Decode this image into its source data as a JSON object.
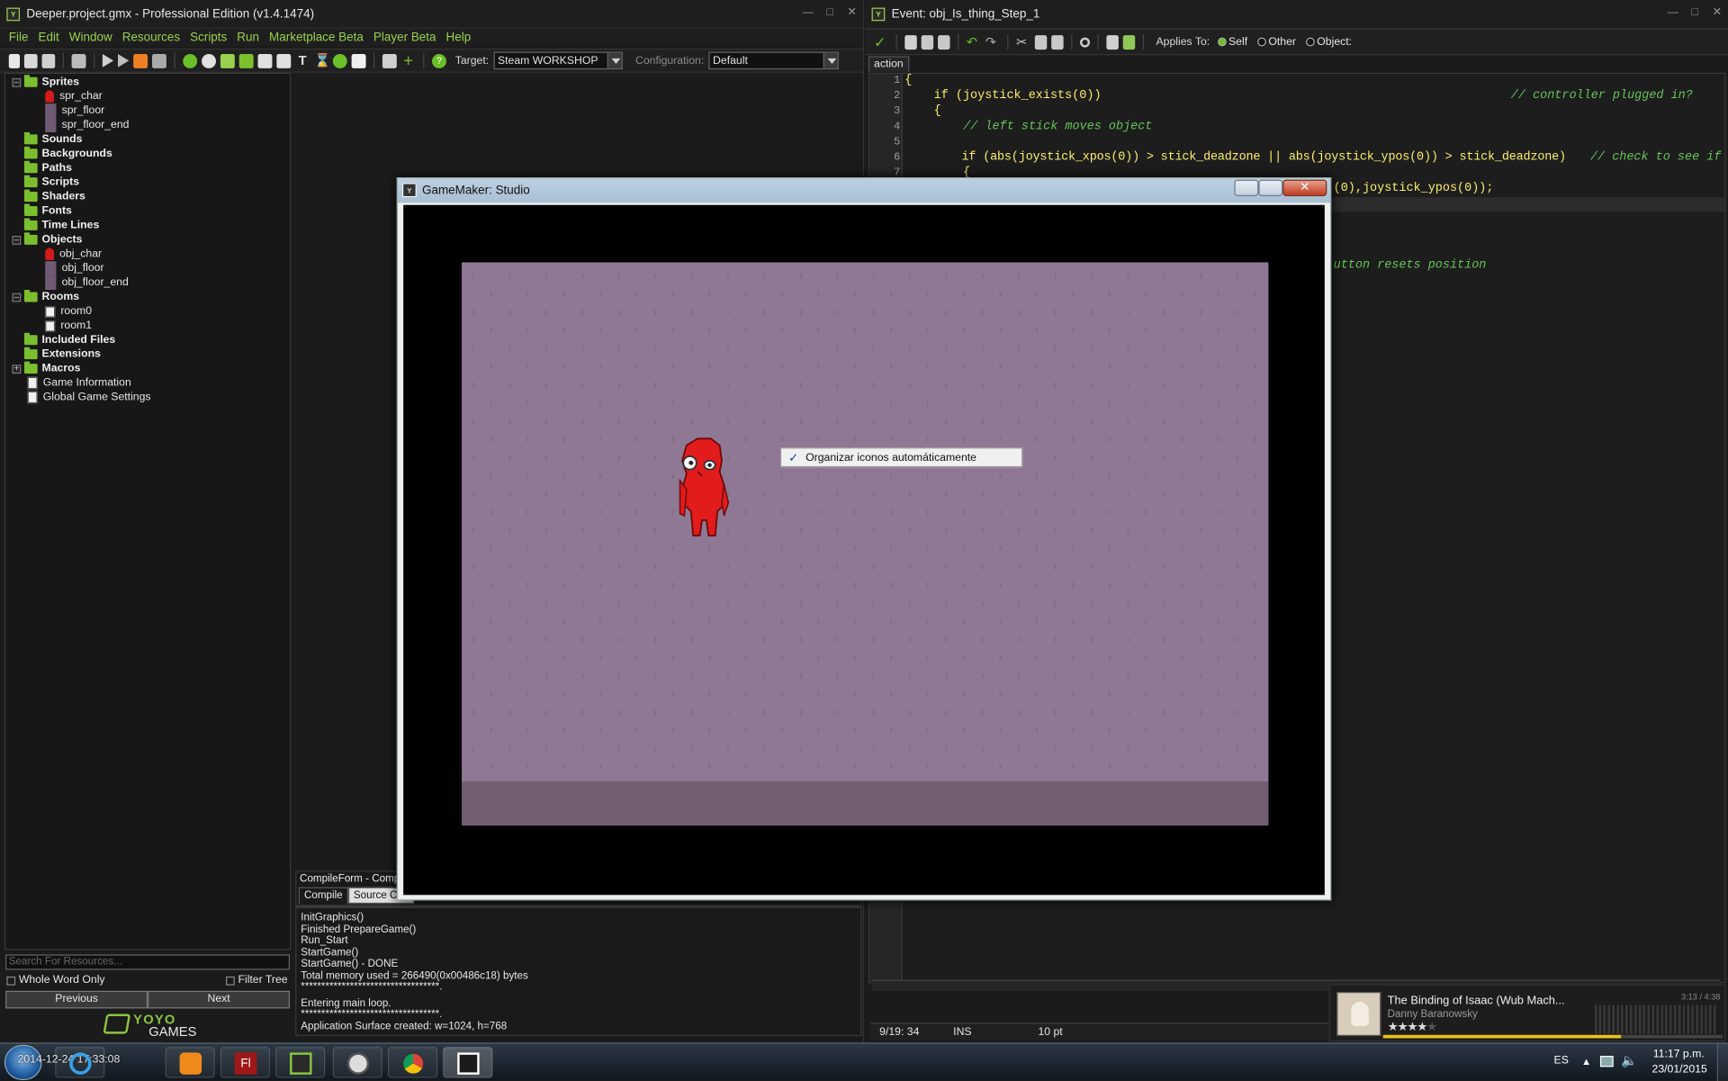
{
  "left_window": {
    "title": "Deeper.project.gmx  -  Professional Edition (v1.4.1474)",
    "menu": [
      "File",
      "Edit",
      "Window",
      "Resources",
      "Scripts",
      "Run",
      "Marketplace Beta",
      "Player Beta",
      "Help"
    ],
    "target_label": "Target:",
    "target_value": "Steam WORKSHOP",
    "configuration_label": "Configuration:",
    "configuration_value": "Default"
  },
  "resource_tree": {
    "sprites": "Sprites",
    "spr_char": "spr_char",
    "spr_floor": "spr_floor",
    "spr_floor_end": "spr_floor_end",
    "sounds": "Sounds",
    "backgrounds": "Backgrounds",
    "paths": "Paths",
    "scripts": "Scripts",
    "shaders": "Shaders",
    "fonts": "Fonts",
    "timelines": "Time Lines",
    "objects": "Objects",
    "obj_char": "obj_char",
    "obj_floor": "obj_floor",
    "obj_floor_end": "obj_floor_end",
    "rooms": "Rooms",
    "room0": "room0",
    "room1": "room1",
    "included_files": "Included Files",
    "extensions": "Extensions",
    "macros": "Macros",
    "game_information": "Game Information",
    "global_settings": "Global Game Settings"
  },
  "search": {
    "placeholder": "Search For Resources...",
    "whole_word": "Whole Word Only",
    "filter_tree": "Filter Tree",
    "previous": "Previous",
    "next": "Next",
    "brand_line1": "YOYO",
    "brand_line2": "GAMES"
  },
  "compile": {
    "title": "CompileForm - Compile",
    "tab_compile": "Compile",
    "tab_source": "Source Con",
    "lines": [
      "InitGraphics()",
      "Finished PrepareGame()",
      "Run_Start",
      "StartGame()",
      "StartGame() - DONE",
      "Total memory used = 266490(0x00486c18) bytes",
      "**********************************.",
      "Entering main loop.",
      "**********************************.",
      "Application Surface created: w=1024, h=768"
    ]
  },
  "code_editor": {
    "title": "Event: obj_Is_thing_Step_1",
    "applies_to": "Applies To:",
    "self": "Self",
    "other": "Other",
    "object": "Object:",
    "tab": "action",
    "line_numbers": [
      "1",
      "2",
      "3",
      "4",
      "5",
      "6",
      "7"
    ],
    "line1": "{",
    "line2": "    if (joystick_exists(0))",
    "line2_comment": "// controller plugged in?",
    "line3": "    {",
    "line4_comment": "// left stick moves object",
    "line6": "        if (abs(joystick_xpos(0)) > stick_deadzone || abs(joystick_ypos(0)) > stick_deadzone)",
    "line6_comment": "// check to see if",
    "line7": "        {",
    "line8_fragment": "(0),joystick_ypos(0));",
    "line_fragment_comment": "utton resets position",
    "status_pos": "9/19:  34",
    "status_ins": "INS",
    "status_font": "10 pt"
  },
  "game_window": {
    "title": "GameMaker: Studio",
    "context_menu_item": "Organizar iconos automáticamente",
    "context_menu_checked": true
  },
  "media_player": {
    "track": "The Binding of Isaac (Wub Mach...",
    "artist": "Danny Baranowsky",
    "time": "3:13 / 4:38",
    "rating": 4,
    "progress": 0.7
  },
  "taskbar": {
    "language": "ES",
    "time": "11:17 p.m.",
    "date": "23/01/2015",
    "overlay_text": "2014-12-24 17:33:08"
  },
  "colors": {
    "accent_green": "#9ad04f",
    "code_yellow": "#ffef6b",
    "comment_green": "#66c45a",
    "room_purple": "#8f7893",
    "char_red": "#e21b1b"
  }
}
